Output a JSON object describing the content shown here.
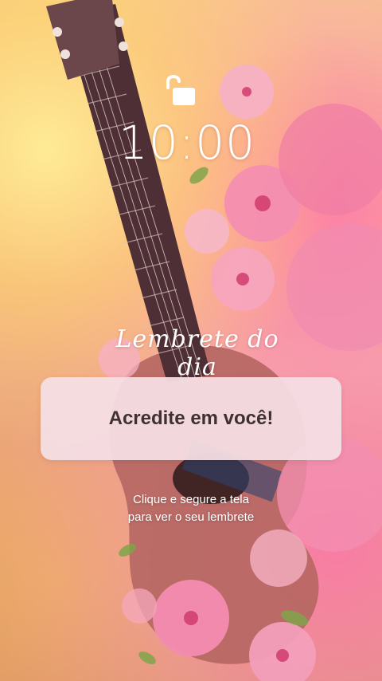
{
  "lockscreen": {
    "lock_icon": "unlocked-padlock-icon",
    "time": "10:00",
    "subtitle": "Lembrete do dia",
    "reminder_text": "Acredite em você!",
    "hint_line1": "Clique e segure a tela",
    "hint_line2": "para ver o seu lembrete"
  },
  "colors": {
    "card_bg": "#f4dee4",
    "card_text": "#3e3033",
    "text_white": "#ffffff"
  }
}
